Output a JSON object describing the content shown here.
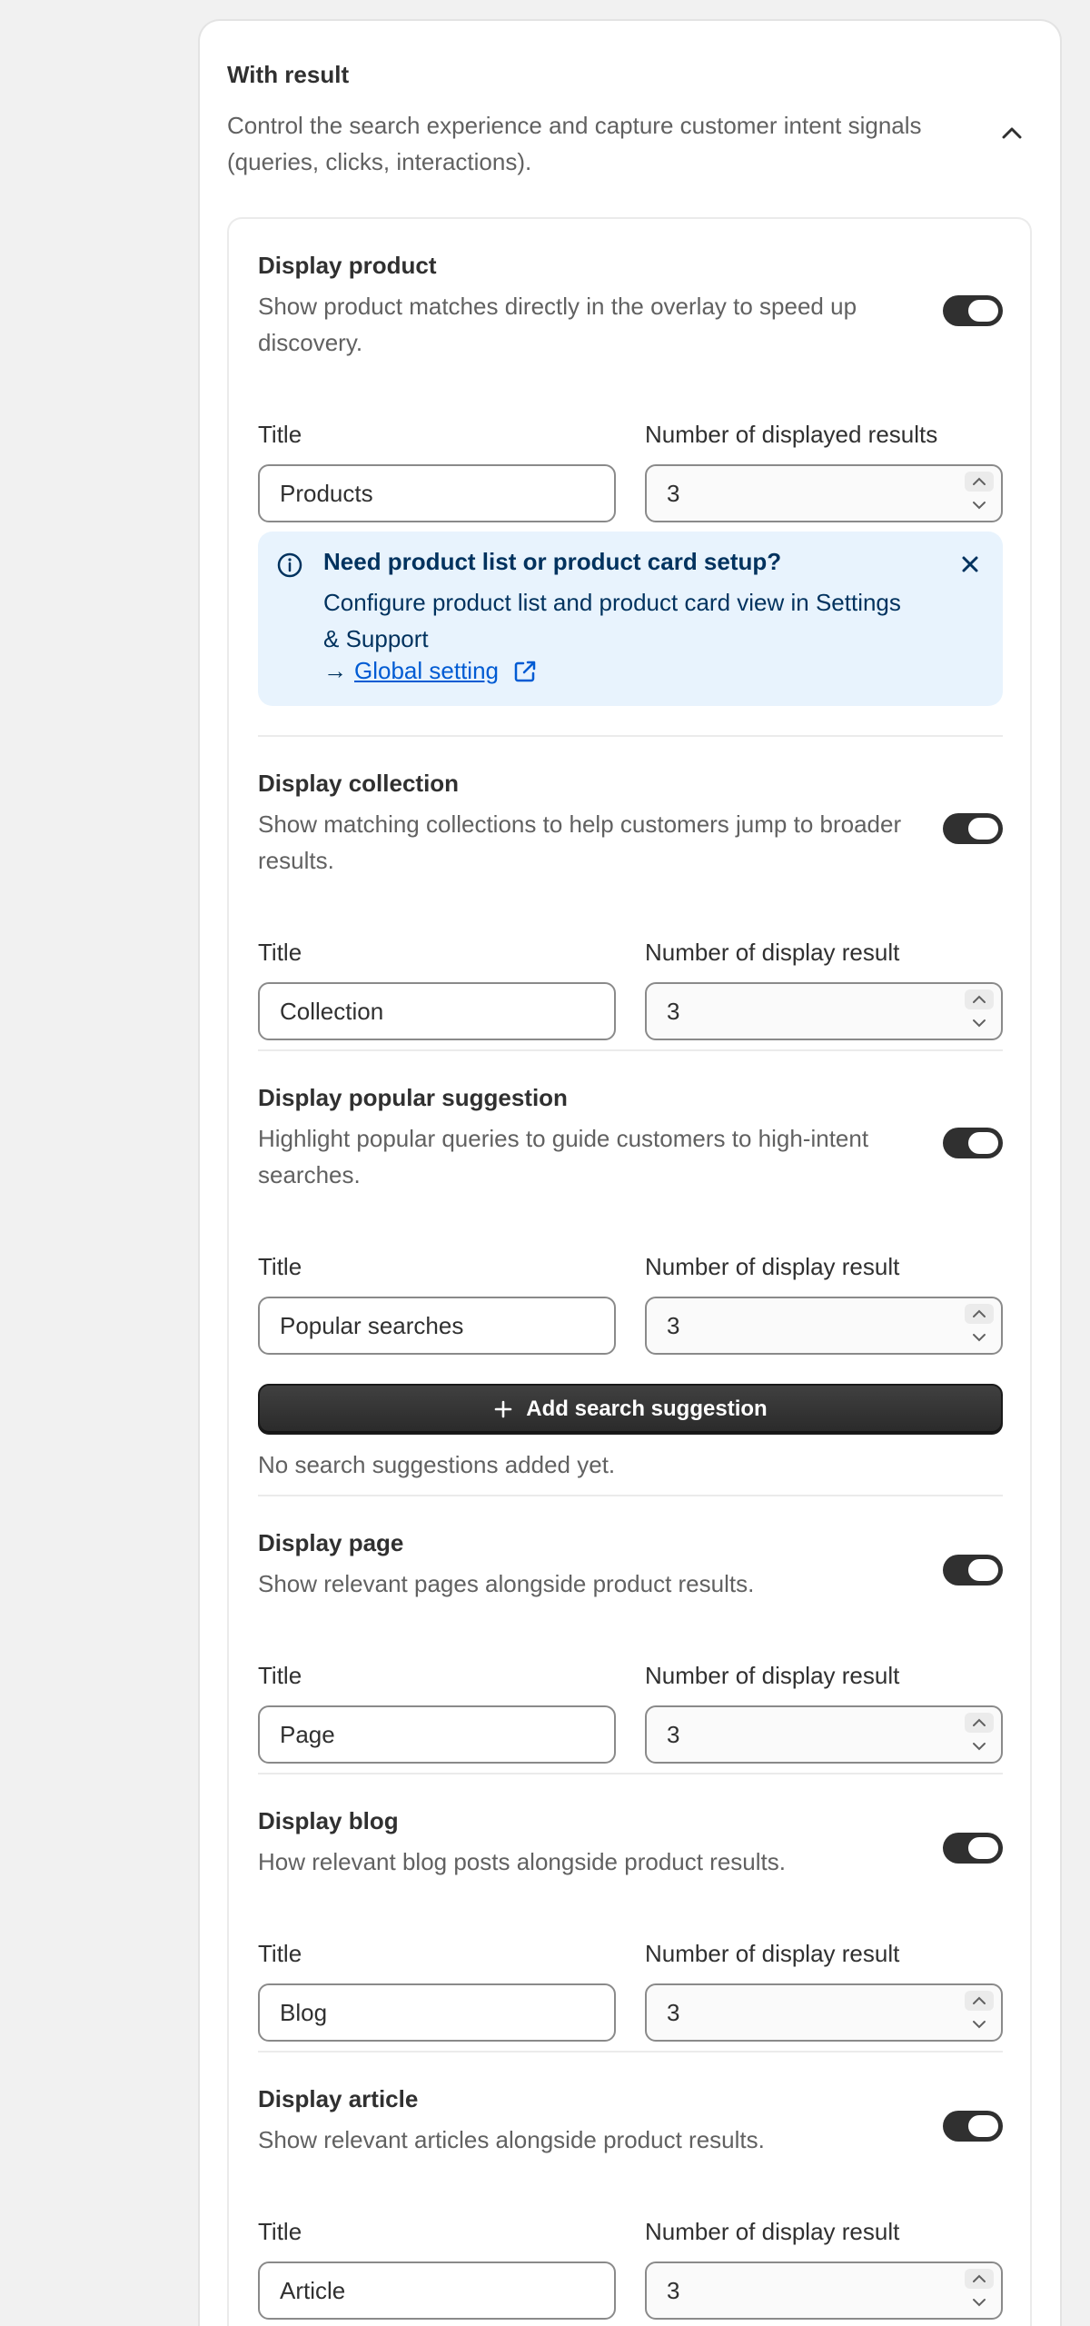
{
  "panel": {
    "title": "With result",
    "description": "Control the search experience and capture customer intent signals (queries, clicks, interactions)."
  },
  "sections": [
    {
      "title": "Display product",
      "description": "Show product matches directly in the overlay to speed up discovery.",
      "enabled": true,
      "title_label": "Title",
      "title_value": "Products",
      "count_label": "Number of displayed results",
      "count_value": "3"
    },
    {
      "title": "Display collection",
      "description": "Show matching collections to help customers jump to broader results.",
      "enabled": true,
      "title_label": "Title",
      "title_value": "Collection",
      "count_label": "Number of display result",
      "count_value": "3"
    },
    {
      "title": "Display popular suggestion",
      "description": "Highlight popular queries to guide customers to high-intent searches.",
      "enabled": true,
      "title_label": "Title",
      "title_value": "Popular searches",
      "count_label": "Number of display result",
      "count_value": "3"
    },
    {
      "title": "Display page",
      "description": "Show relevant pages alongside product results.",
      "enabled": true,
      "title_label": "Title",
      "title_value": "Page",
      "count_label": "Number of display result",
      "count_value": "3"
    },
    {
      "title": "Display blog",
      "description": "How relevant blog posts alongside product results.",
      "enabled": true,
      "title_label": "Title",
      "title_value": "Blog",
      "count_label": "Number of display result",
      "count_value": "3"
    },
    {
      "title": "Display article",
      "description": "Show relevant articles alongside product results.",
      "enabled": true,
      "title_label": "Title",
      "title_value": "Article",
      "count_label": "Number of display result",
      "count_value": "3"
    }
  ],
  "banner": {
    "title": "Need product list or product card setup?",
    "body": "Configure product list and product card view in Settings & Support",
    "arrow": "→",
    "link_label": "Global setting"
  },
  "suggestions": {
    "add_button_label": "Add search suggestion",
    "empty_text": "No search suggestions added yet."
  },
  "colors": {
    "toggle_on": "#303030",
    "banner_bg": "#e8f3fd",
    "link": "#005bd3"
  }
}
